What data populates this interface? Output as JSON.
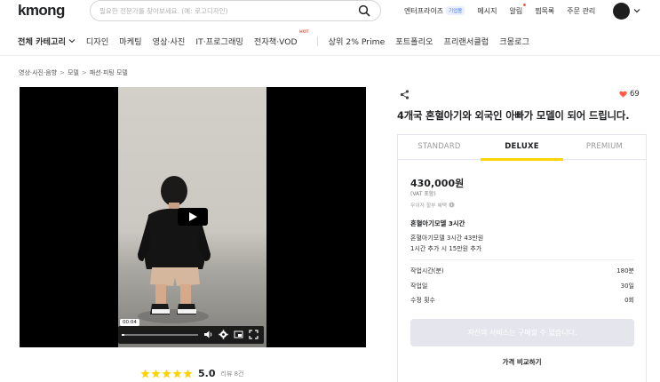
{
  "header": {
    "logo": "kmong",
    "search_placeholder": "필요한 전문가를 찾아보세요. (예: 로고디자인)",
    "nav": {
      "enterprise": "엔터프라이즈",
      "enterprise_badge": "기업용",
      "messages": "메시지",
      "notifications": "알림",
      "wishlist": "찜목록",
      "orders": "주문 관리"
    }
  },
  "category_nav": {
    "all": "전체 카테고리",
    "items": [
      "디자인",
      "마케팅",
      "영상·사진",
      "IT·프로그래밍",
      "전자책·VOD"
    ],
    "hot_badge": "HOT",
    "extra": [
      "상위 2% Prime",
      "포트폴리오",
      "프리랜서클럽",
      "크몽로그"
    ]
  },
  "breadcrumb": [
    "영상·사진·음향",
    "모델",
    "패션·피팅 모델"
  ],
  "video": {
    "time_tooltip": "00:04",
    "progress": 0.03
  },
  "rating": {
    "stars": 5,
    "score": "5.0",
    "reviews": "리뷰 8건"
  },
  "service": {
    "likes": "69",
    "title": "4개국 혼혈아기와 외국인 아빠가 모델이 되어 드립니다."
  },
  "package": {
    "tabs": [
      "STANDARD",
      "DELUXE",
      "PREMIUM"
    ],
    "active_tab": 1,
    "price": "430,000원",
    "vat": "(VAT 포함)",
    "no_interest": "무이자 할부 혜택",
    "name": "혼혈아기모델 3시간",
    "desc_lines": [
      "혼혈아기모델 3시간 43만원",
      "1시간 추가 시 15만원 추가"
    ],
    "specs": [
      {
        "label": "작업시간(분)",
        "value": "180분"
      },
      {
        "label": "작업일",
        "value": "30일"
      },
      {
        "label": "수정 횟수",
        "value": "0회"
      }
    ],
    "buy_button": "자신의 서비스는 구매할 수 없습니다.",
    "compare_link": "가격 비교하기"
  },
  "colors": {
    "accent_yellow": "#ffd400",
    "star": "#ffd400",
    "heart": "#ff5a44",
    "disabled_button": "#e4e5ed"
  }
}
